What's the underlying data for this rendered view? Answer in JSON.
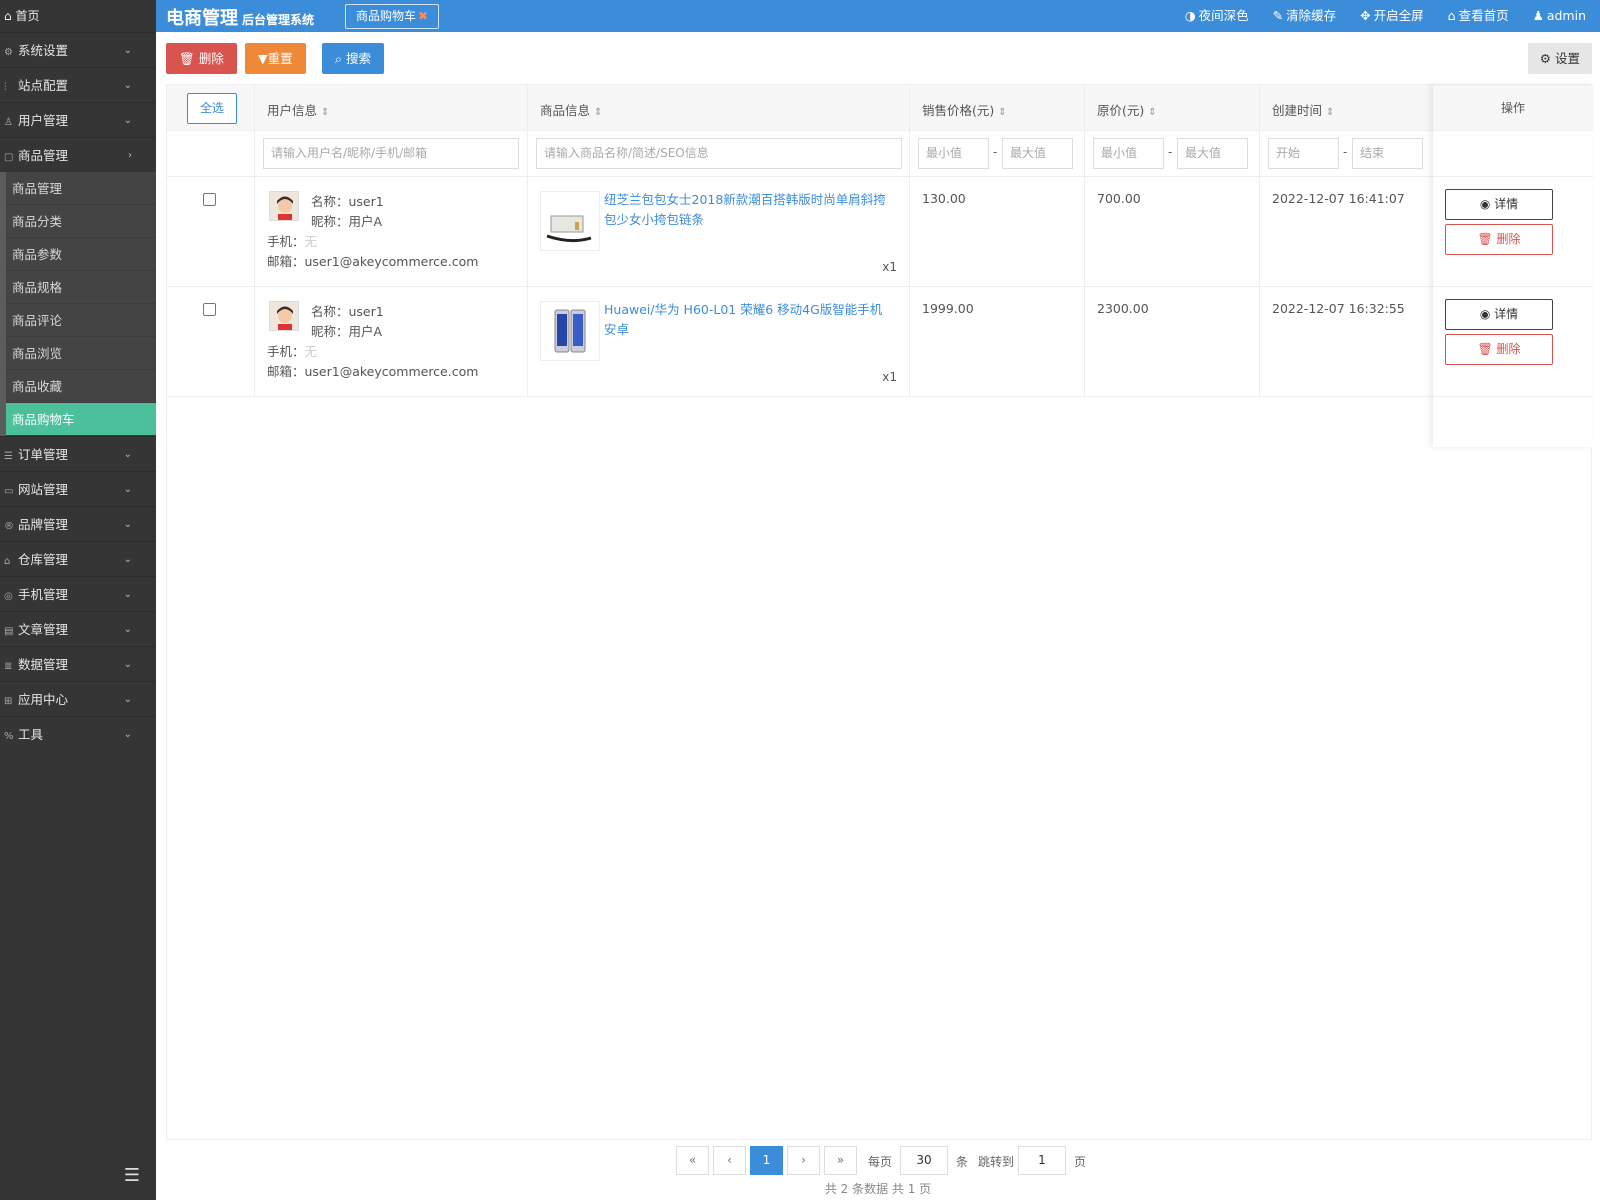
{
  "sidebar": {
    "home": "首页",
    "menus": [
      {
        "label": "系统设置",
        "icon": "gear-icon"
      },
      {
        "label": "站点配置",
        "icon": "sliders-icon"
      },
      {
        "label": "用户管理",
        "icon": "user-icon"
      },
      {
        "label": "商品管理",
        "icon": "box-icon"
      }
    ],
    "sub_items": [
      "商品管理",
      "商品分类",
      "商品参数",
      "商品规格",
      "商品评论",
      "商品浏览",
      "商品收藏",
      "商品购物车"
    ],
    "menus_after": [
      {
        "label": "订单管理",
        "icon": "order-icon"
      },
      {
        "label": "网站管理",
        "icon": "site-icon"
      },
      {
        "label": "品牌管理",
        "icon": "brand-icon"
      },
      {
        "label": "仓库管理",
        "icon": "warehouse-icon"
      },
      {
        "label": "手机管理",
        "icon": "phone-icon"
      },
      {
        "label": "文章管理",
        "icon": "article-icon"
      },
      {
        "label": "数据管理",
        "icon": "database-icon"
      },
      {
        "label": "应用中心",
        "icon": "apps-icon"
      },
      {
        "label": "工具",
        "icon": "tools-icon"
      }
    ]
  },
  "header": {
    "brand": "电商管理",
    "brand_sub": "后台管理系统",
    "tab": "商品购物车",
    "actions": [
      "夜间深色",
      "清除缓存",
      "开启全屏",
      "查看首页",
      "admin"
    ]
  },
  "toolbar": {
    "delete": "删除",
    "reset": "重置",
    "search": "搜索",
    "settings": "设置"
  },
  "table": {
    "select_all": "全选",
    "columns": [
      "用户信息",
      "商品信息",
      "销售价格(元)",
      "原价(元)",
      "创建时间",
      "操作"
    ],
    "filters": {
      "user": "请输入用户名/昵称/手机/邮箱",
      "goods": "请输入商品名称/简述/SEO信息",
      "min": "最小值",
      "max": "最大值",
      "start": "开始",
      "end": "结束",
      "dash": "-"
    },
    "rows": [
      {
        "name_label": "名称：user1",
        "nick_label": "昵称：用户A",
        "phone_label": "手机：",
        "phone_val": "无",
        "email_label": "邮箱：user1@akeycommerce.com",
        "goods_title": "纽芝兰包包女士2018新款潮百搭韩版时尚单肩斜挎包少女小挎包链条",
        "qty": "x1",
        "price": "130.00",
        "original": "700.00",
        "created": "2022-12-07 16:41:07",
        "detail": "详情",
        "delete": "删除"
      },
      {
        "name_label": "名称：user1",
        "nick_label": "昵称：用户A",
        "phone_label": "手机：",
        "phone_val": "无",
        "email_label": "邮箱：user1@akeycommerce.com",
        "goods_title": "Huawei/华为 H60-L01 荣耀6 移动4G版智能手机 安卓",
        "qty": "x1",
        "price": "1999.00",
        "original": "2300.00",
        "created": "2022-12-07 16:32:55",
        "detail": "详情",
        "delete": "删除"
      }
    ]
  },
  "pagination": {
    "first": "«",
    "prev": "‹",
    "current": "1",
    "next": "›",
    "last": "»",
    "per_page_label": "每页",
    "per_page": "30",
    "per_page_unit": "条",
    "jump_label": "跳转到",
    "jump_page": "1",
    "jump_unit": "页",
    "summary": "共 2 条数据   共 1 页"
  }
}
